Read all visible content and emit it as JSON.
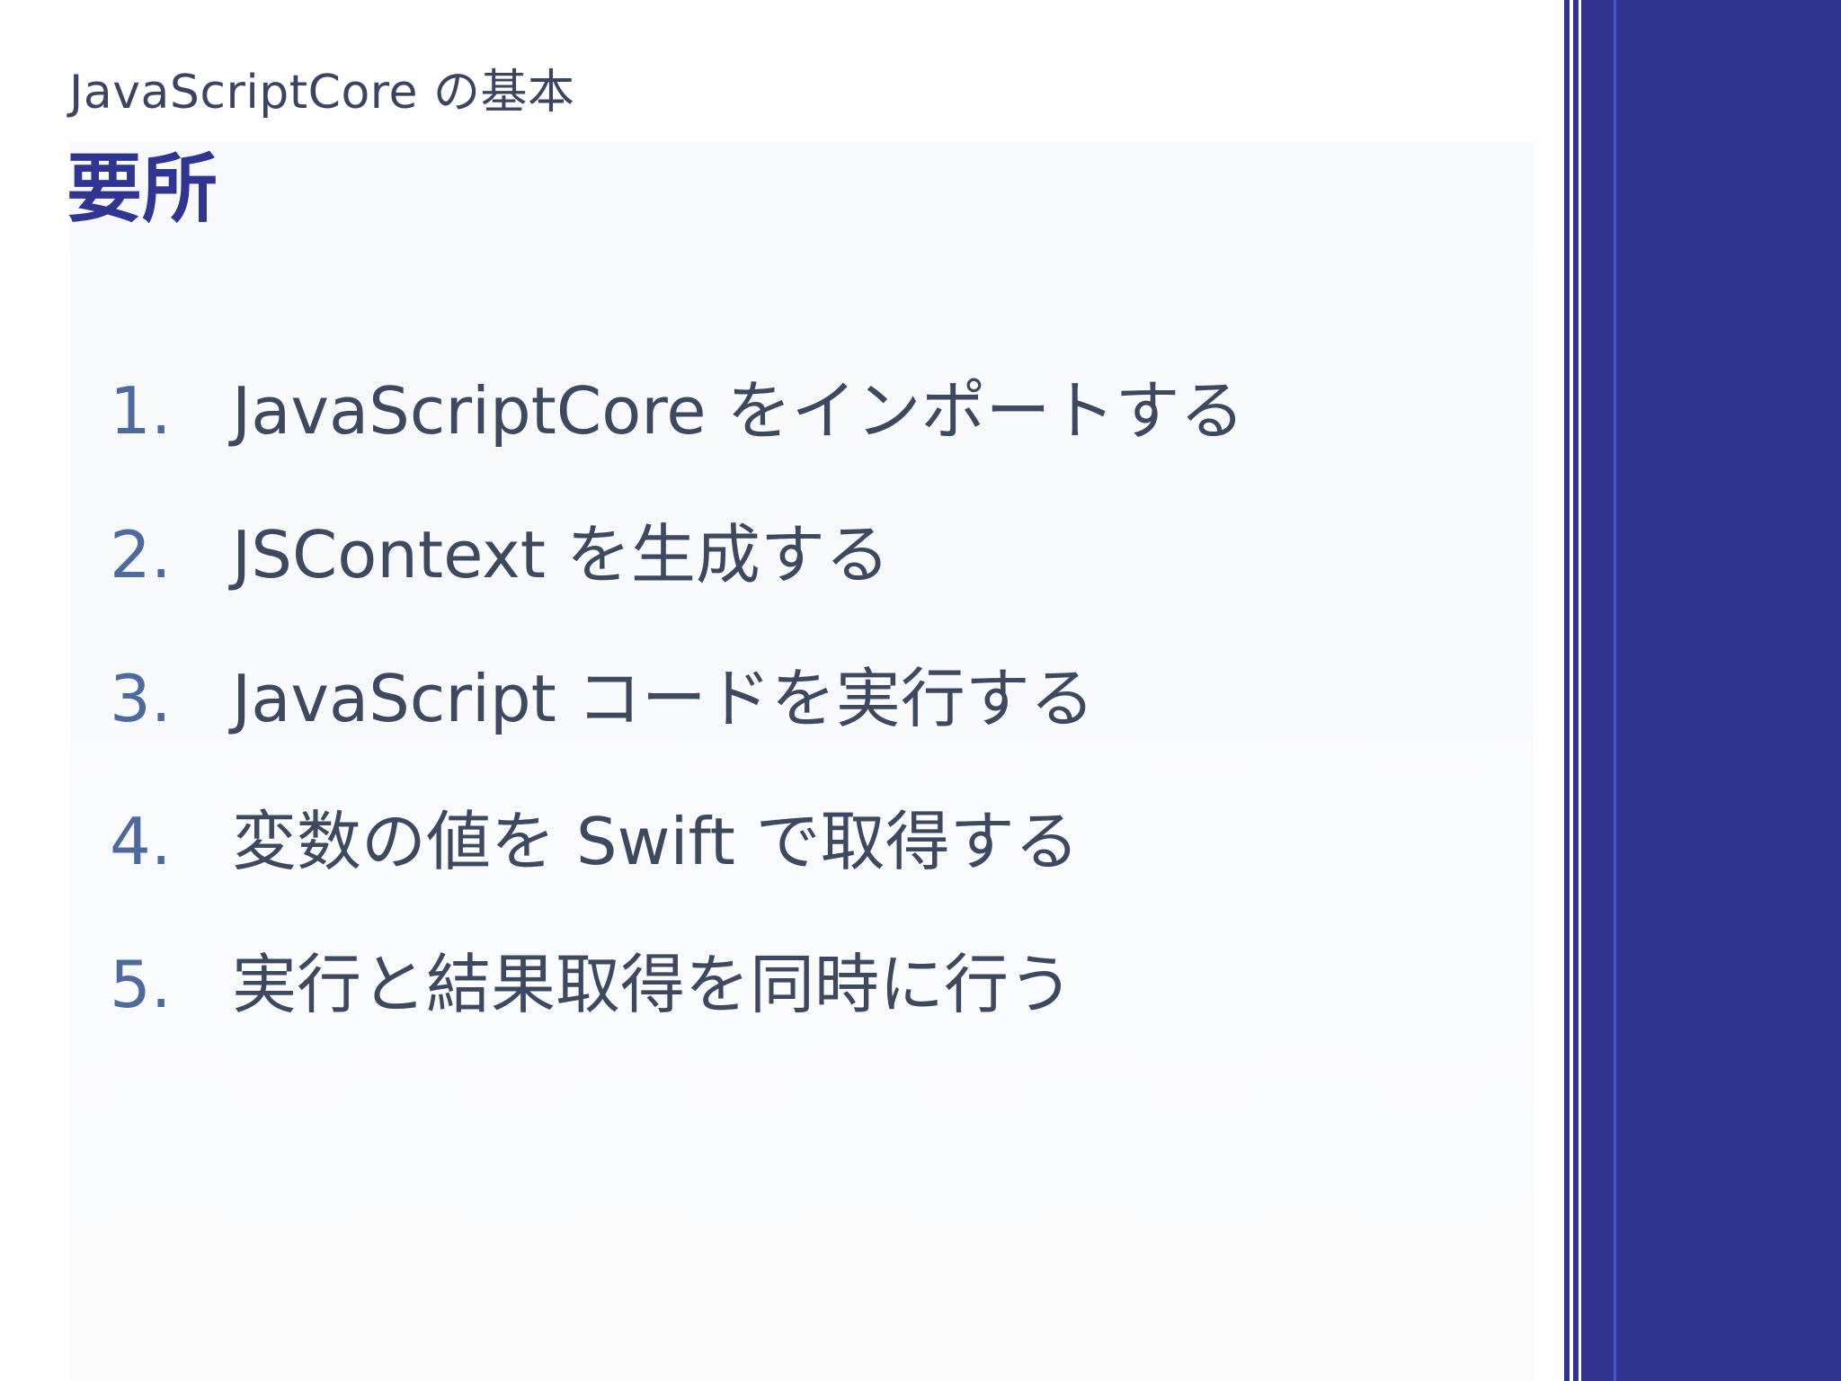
{
  "slide": {
    "subtitle": "JavaScriptCore の基本",
    "title": "要所",
    "items": [
      {
        "number": "1.",
        "text": "JavaScriptCore をインポートする"
      },
      {
        "number": "2.",
        "text": "JSContext を生成する"
      },
      {
        "number": "3.",
        "text": "JavaScript コードを実行する"
      },
      {
        "number": "4.",
        "text": "変数の値を Swift で取得する"
      },
      {
        "number": "5.",
        "text": "実行と結果取得を同時に行う"
      }
    ]
  },
  "colors": {
    "accent": "#2e3593",
    "sidebar": "#30348f",
    "body_text": "#3d4960",
    "number_text": "#4d6a9e"
  }
}
